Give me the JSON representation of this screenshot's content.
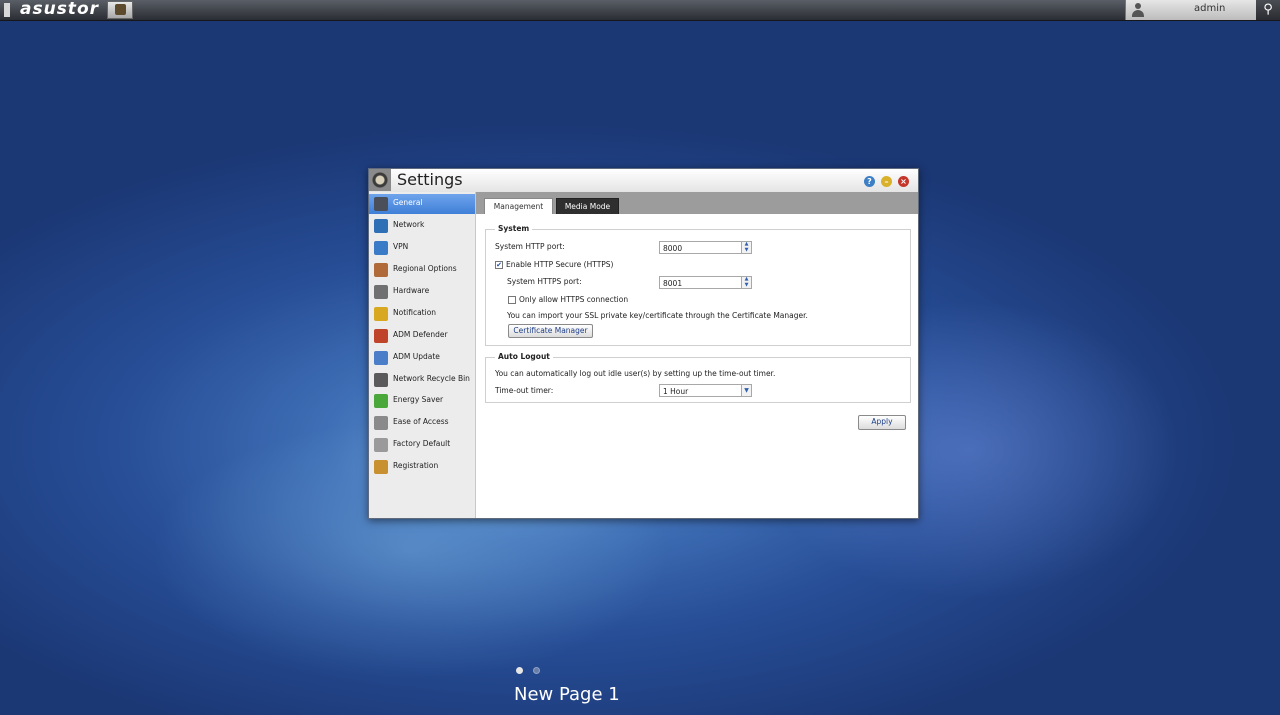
{
  "topbar": {
    "brand": "asustor",
    "user": "admin",
    "icons": {
      "app": "adm-app-icon",
      "user": "user-icon",
      "search": "search-icon"
    }
  },
  "window": {
    "title": "Settings",
    "controls": {
      "help": "?",
      "minimize": "–",
      "close": "×"
    },
    "sidebar": [
      {
        "label": "General",
        "icon": "general-icon",
        "color": "#4a4f5a",
        "active": true
      },
      {
        "label": "Network",
        "icon": "network-icon",
        "color": "#2f6fb5"
      },
      {
        "label": "VPN",
        "icon": "vpn-icon",
        "color": "#3a7bc8"
      },
      {
        "label": "Regional Options",
        "icon": "regional-options-icon",
        "color": "#b06a3a"
      },
      {
        "label": "Hardware",
        "icon": "hardware-icon",
        "color": "#707070"
      },
      {
        "label": "Notification",
        "icon": "notification-icon",
        "color": "#d8a820"
      },
      {
        "label": "ADM Defender",
        "icon": "adm-defender-icon",
        "color": "#c0442a"
      },
      {
        "label": "ADM Update",
        "icon": "adm-update-icon",
        "color": "#4a7ec8"
      },
      {
        "label": "Network Recycle Bin",
        "icon": "recycle-bin-icon",
        "color": "#5a5a5a"
      },
      {
        "label": "Energy Saver",
        "icon": "energy-saver-icon",
        "color": "#4aa83a"
      },
      {
        "label": "Ease of Access",
        "icon": "ease-of-access-icon",
        "color": "#8a8a8a"
      },
      {
        "label": "Factory Default",
        "icon": "factory-default-icon",
        "color": "#9a9a9a"
      },
      {
        "label": "Registration",
        "icon": "registration-icon",
        "color": "#c89030"
      }
    ],
    "tabs": {
      "management": "Management",
      "media_mode": "Media Mode"
    },
    "system": {
      "title": "System",
      "http_port_label": "System HTTP port:",
      "http_port": "8000",
      "https_enable_label": "Enable HTTP Secure (HTTPS)",
      "https_enabled": "✔",
      "https_port_label": "System HTTPS port:",
      "https_port": "8001",
      "https_only_label": "Only allow HTTPS connection",
      "ssl_note": "You can import your SSL private key/certificate through the Certificate Manager.",
      "cert_button": "Certificate Manager"
    },
    "auto_logout": {
      "title": "Auto Logout",
      "description": "You can automatically log out idle user(s) by setting up the time-out timer.",
      "timer_label": "Time-out timer:",
      "timer_value": "1 Hour"
    },
    "apply_label": "Apply"
  },
  "desktop": {
    "page_label": "New Page 1"
  }
}
